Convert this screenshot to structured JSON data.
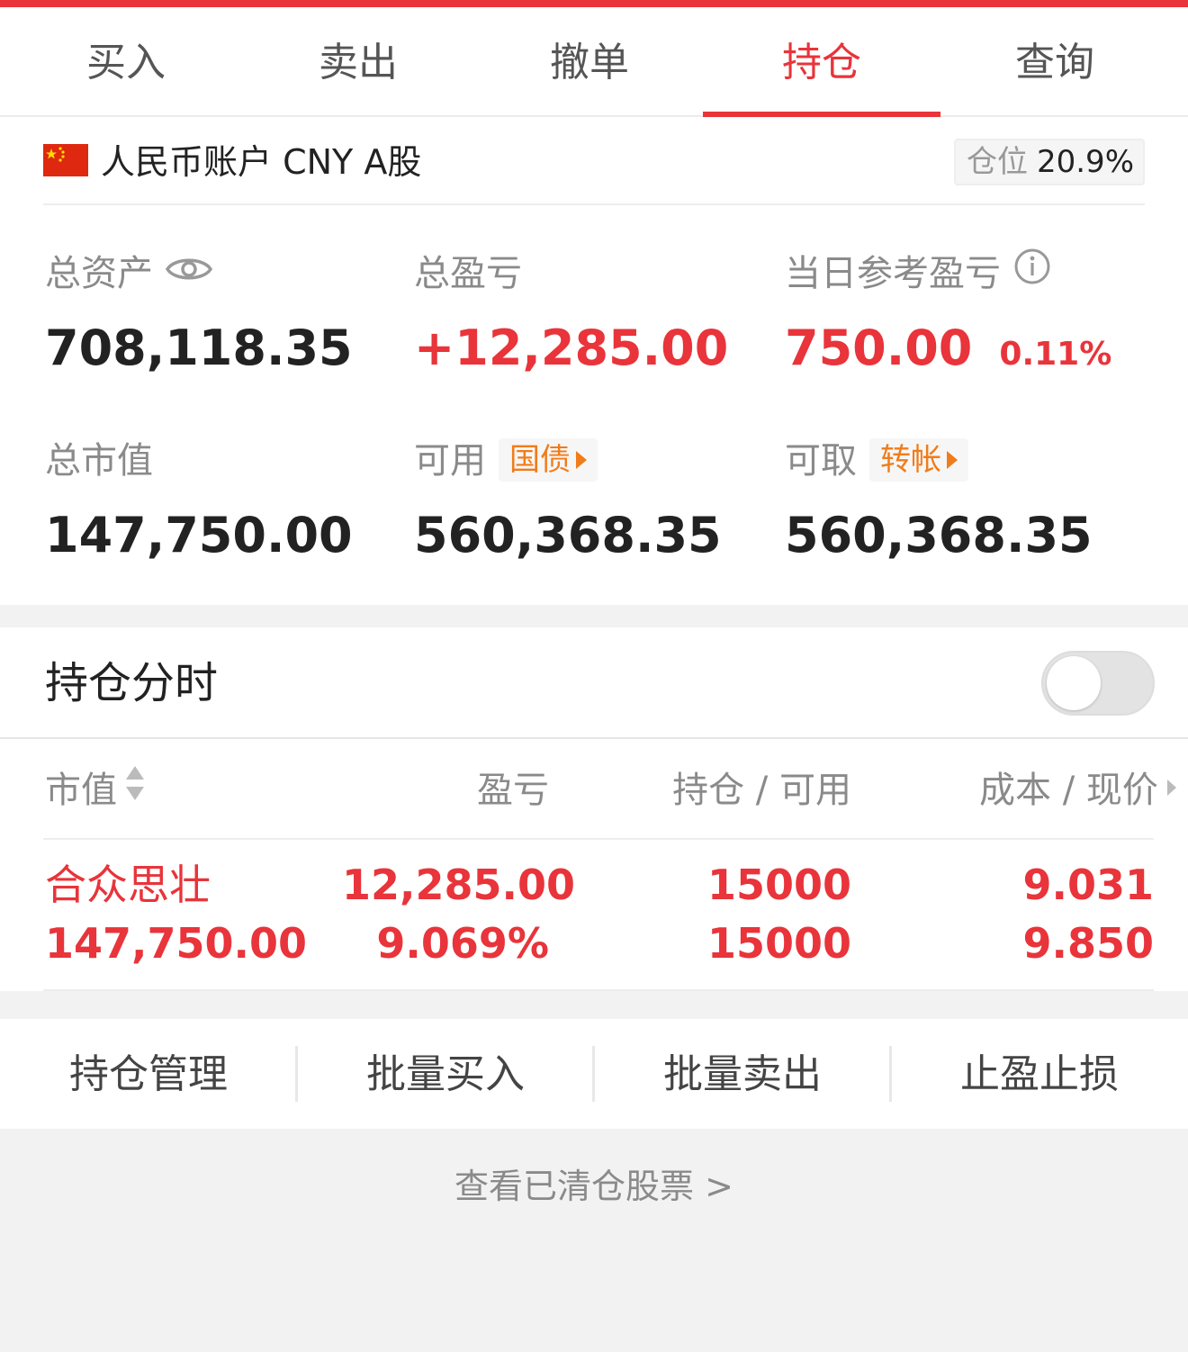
{
  "tabs": [
    {
      "label": "买入"
    },
    {
      "label": "卖出"
    },
    {
      "label": "撤单"
    },
    {
      "label": "持仓"
    },
    {
      "label": "查询"
    }
  ],
  "active_tab": "持仓",
  "account": {
    "name": "人民币账户 CNY A股",
    "position_label": "仓位",
    "position_value": "20.9%"
  },
  "metrics": {
    "total_assets": {
      "label": "总资产",
      "value": "708,118.35"
    },
    "total_pnl": {
      "label": "总盈亏",
      "value": "+12,285.00"
    },
    "daily_pnl": {
      "label": "当日参考盈亏",
      "value": "750.00",
      "percent": "0.11%"
    },
    "market_value": {
      "label": "总市值",
      "value": "147,750.00"
    },
    "available": {
      "label": "可用",
      "tag": "国债",
      "value": "560,368.35"
    },
    "withdrawable": {
      "label": "可取",
      "tag": "转帐",
      "value": "560,368.35"
    }
  },
  "holding_timeshare": {
    "title": "持仓分时",
    "toggle_on": false
  },
  "table": {
    "headers": {
      "market_value": "市值",
      "pnl": "盈亏",
      "position": "持仓 / 可用",
      "cost": "成本 / 现价"
    },
    "rows": [
      {
        "name": "合众思壮",
        "market_value": "147,750.00",
        "pnl": "12,285.00",
        "pnl_pct": "9.069%",
        "position": "15000",
        "available": "15000",
        "cost": "9.031",
        "price": "9.850"
      }
    ]
  },
  "actions": [
    {
      "label": "持仓管理"
    },
    {
      "label": "批量买入"
    },
    {
      "label": "批量卖出"
    },
    {
      "label": "止盈止损"
    }
  ],
  "cleared_link": "查看已清仓股票 >",
  "colors": {
    "accent": "#e8343a",
    "tag": "#f07c1a",
    "muted": "#8a8a8a"
  }
}
